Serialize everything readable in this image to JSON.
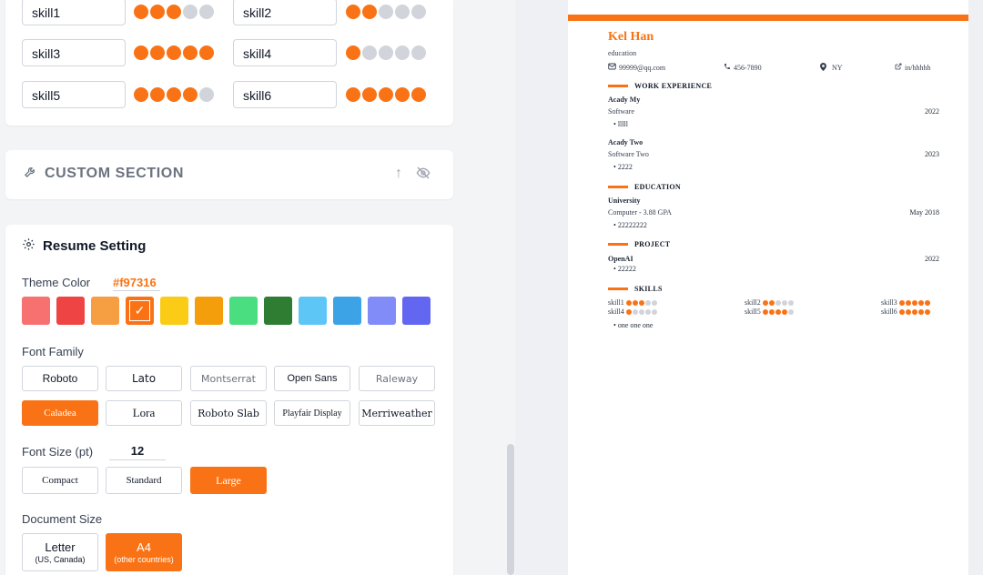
{
  "skills": [
    {
      "name": "skill1",
      "level": 3
    },
    {
      "name": "skill2",
      "level": 2
    },
    {
      "name": "skill3",
      "level": 5
    },
    {
      "name": "skill4",
      "level": 1
    },
    {
      "name": "skill5",
      "level": 4
    },
    {
      "name": "skill6",
      "level": 5
    }
  ],
  "custom_section": {
    "title": "CUSTOM SECTION"
  },
  "settings": {
    "title": "Resume Setting",
    "theme_label": "Theme Color",
    "theme_value": "#f97316",
    "swatches": [
      "#f87171",
      "#ef4444",
      "#f59e42",
      "#f97316",
      "#facc15",
      "#f59e0b",
      "#4ade80",
      "#2e7d32",
      "#5ec6f7",
      "#3ba3e6",
      "#818cf8",
      "#6366f1"
    ],
    "selected_swatch_mark": "✓",
    "font_family_label": "Font Family",
    "fonts": [
      "Roboto",
      "Lato",
      "Montserrat",
      "Open Sans",
      "Raleway",
      "Caladea",
      "Lora",
      "Roboto Slab",
      "Playfair Display",
      "Merriweather"
    ],
    "selected_font": "Caladea",
    "font_size_label": "Font Size (pt)",
    "font_size_value": "12",
    "sizes": [
      "Compact",
      "Standard",
      "Large"
    ],
    "selected_size": "Large",
    "doc_size_label": "Document Size",
    "doc_sizes": [
      {
        "main": "Letter",
        "sub": "(US, Canada)"
      },
      {
        "main": "A4",
        "sub": "(other countries)"
      }
    ],
    "selected_doc": "A4"
  },
  "resume": {
    "name": "Kel Han",
    "summary": "education",
    "email": "99999@qq.com",
    "phone": "456-7890",
    "location": "NY",
    "linkedin": "in/hhhhh",
    "work_heading": "WORK EXPERIENCE",
    "work": [
      {
        "company": "Acady My",
        "title": "Software",
        "date": "2022",
        "bullet": "lllll"
      },
      {
        "company": "Acady Two",
        "title": "Software Two",
        "date": "2023",
        "bullet": "2222"
      }
    ],
    "education_heading": "EDUCATION",
    "education": {
      "school": "University",
      "degree": "Computer - 3.88 GPA",
      "date": "May 2018",
      "bullet": "22222222"
    },
    "project_heading": "PROJECT",
    "project": {
      "name": "OpenAI",
      "date": "2022",
      "bullet": "22222"
    },
    "skills_heading": "SKILLS",
    "skills_bullet": "one one one"
  }
}
